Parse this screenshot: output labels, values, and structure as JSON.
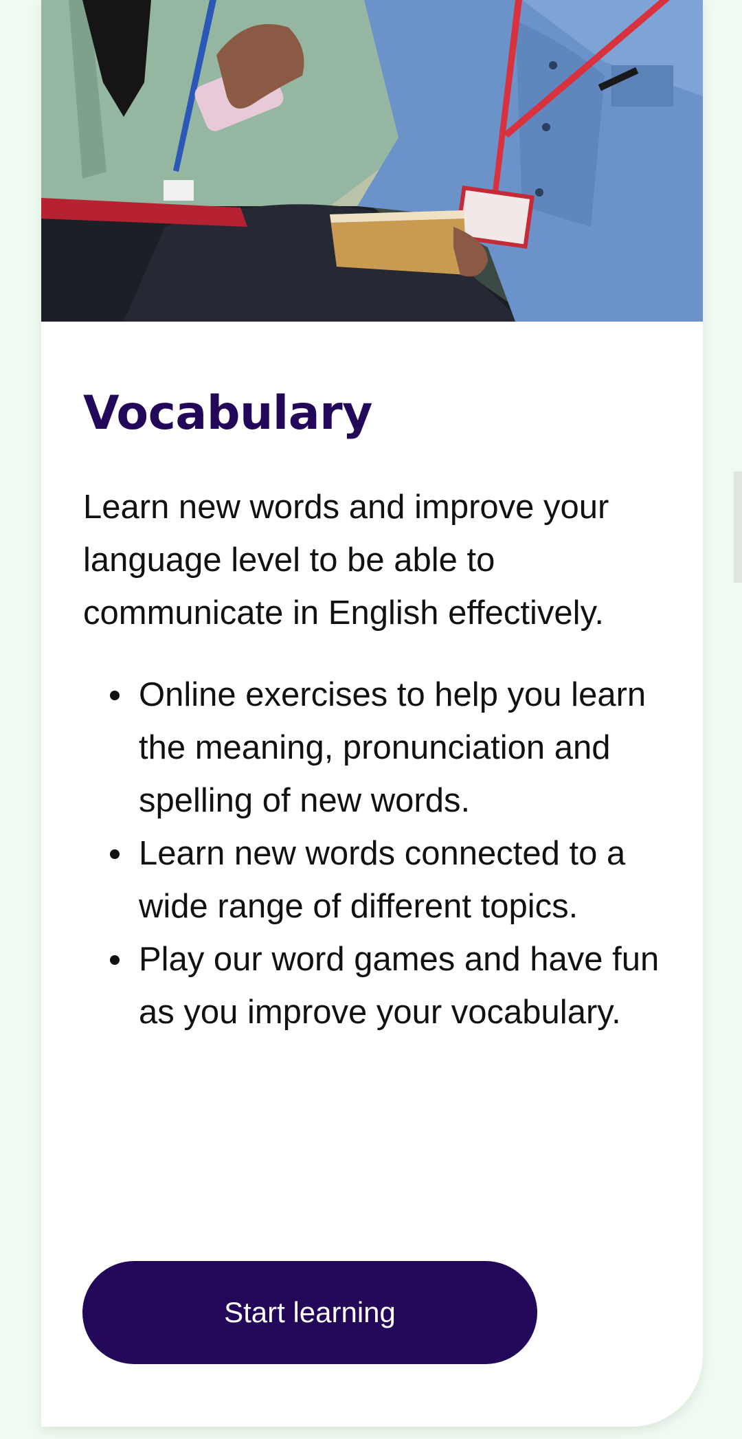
{
  "card": {
    "title": "Vocabulary",
    "description": "Learn new words and improve your language level to be able to communicate in English effectively.",
    "bullets": [
      "Online exercises to help you learn the meaning, pronunciation and spelling of new words.",
      "Learn new words connected to a wide range of different topics.",
      "Play our word games and have fun as you improve your vocabulary."
    ],
    "button_label": "Start learning"
  },
  "colors": {
    "background": "#effaf0",
    "card": "#ffffff",
    "heading": "#23085a",
    "button": "#23085a",
    "button_text": "#ffffff",
    "body_text": "#111111"
  }
}
